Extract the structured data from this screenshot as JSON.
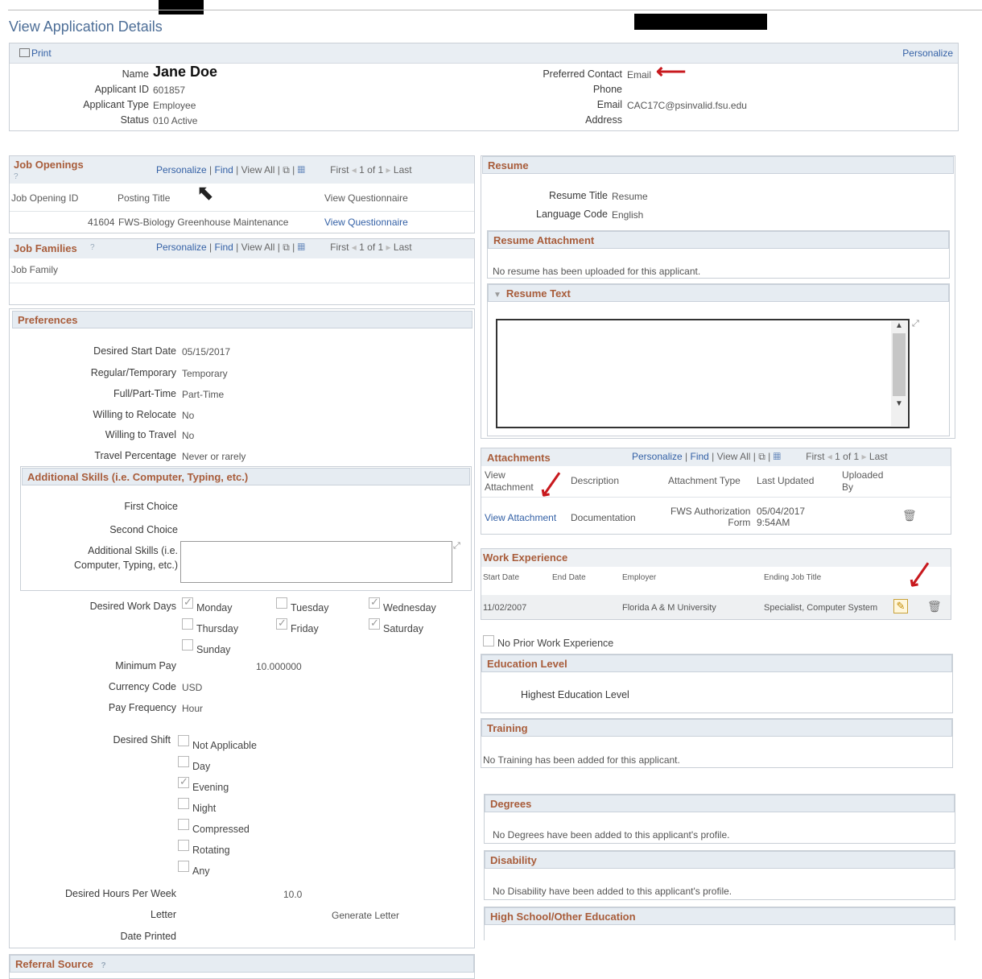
{
  "page_title": "View Application Details",
  "toolbar": {
    "print": "Print",
    "personalize": "Personalize"
  },
  "applicant": {
    "name_label": "Name",
    "name": "Jane Doe",
    "id_label": "Applicant ID",
    "id": "601857",
    "type_label": "Applicant Type",
    "type": "Employee",
    "status_label": "Status",
    "status": "010 Active",
    "pref_contact_label": "Preferred Contact",
    "pref_contact": "Email",
    "phone_label": "Phone",
    "email_label": "Email",
    "email": "CAC17C@psinvalid.fsu.edu",
    "address_label": "Address"
  },
  "grid_nav": {
    "personalize": "Personalize",
    "find": "Find",
    "view_all": "View All",
    "first": "First",
    "count": "1 of 1",
    "last": "Last"
  },
  "job_openings": {
    "title": "Job Openings",
    "cols": [
      "Job Opening ID",
      "Posting Title",
      "View Questionnaire"
    ],
    "row": {
      "id": "41604",
      "title": "FWS-Biology Greenhouse Maintenance",
      "link": "View Questionnaire"
    }
  },
  "job_families": {
    "title": "Job Families",
    "col": "Job Family"
  },
  "preferences": {
    "title": "Preferences",
    "rows": [
      {
        "label": "Desired Start Date",
        "value": "05/15/2017"
      },
      {
        "label": "Regular/Temporary",
        "value": "Temporary"
      },
      {
        "label": "Full/Part-Time",
        "value": "Part-Time"
      },
      {
        "label": "Willing to Relocate",
        "value": "No"
      },
      {
        "label": "Willing to Travel",
        "value": "No"
      },
      {
        "label": "Travel Percentage",
        "value": "Never or rarely"
      }
    ],
    "skills_title": "Additional Skills (i.e. Computer, Typing, etc.)",
    "first_choice": "First Choice",
    "second_choice": "Second Choice",
    "skills_field_1": "Additional Skills (i.e.",
    "skills_field_2": "Computer, Typing, etc.)",
    "work_days_label": "Desired Work Days",
    "days": [
      "Monday",
      "Tuesday",
      "Wednesday",
      "Thursday",
      "Friday",
      "Saturday",
      "Sunday"
    ],
    "min_pay_label": "Minimum Pay",
    "min_pay": "10.000000",
    "currency_label": "Currency Code",
    "currency": "USD",
    "freq_label": "Pay Frequency",
    "freq": "Hour",
    "shift_label": "Desired Shift",
    "shifts": [
      "Not Applicable",
      "Day",
      "Evening",
      "Night",
      "Compressed",
      "Rotating",
      "Any"
    ],
    "hours_label": "Desired Hours Per Week",
    "hours": "10.0",
    "letter_label": "Letter",
    "letter": "Generate Letter",
    "date_printed_label": "Date Printed"
  },
  "referral": {
    "title": "Referral Source"
  },
  "resume": {
    "title": "Resume",
    "title_label": "Resume Title",
    "title_value": "Resume",
    "lang_label": "Language Code",
    "lang_value": "English",
    "attach_title": "Resume Attachment",
    "attach_msg": "No resume has been uploaded for this applicant.",
    "text_title": "Resume Text"
  },
  "attachments": {
    "title": "Attachments",
    "cols": [
      "View Attachment",
      "Description",
      "Attachment Type",
      "Last Updated",
      "Uploaded By"
    ],
    "row": {
      "link": "View Attachment",
      "desc": "Documentation",
      "type1": "FWS Authorization",
      "type2": "Form",
      "date": "05/04/2017",
      "time": "9:54AM"
    }
  },
  "work_experience": {
    "title": "Work Experience",
    "cols": [
      "Start Date",
      "End Date",
      "Employer",
      "Ending Job Title"
    ],
    "row": {
      "start": "11/02/2007",
      "employer": "Florida A & M University",
      "job_title": "Specialist, Computer System"
    },
    "no_prior": "No Prior Work Experience"
  },
  "education": {
    "title": "Education Level",
    "label": "Highest Education Level"
  },
  "training": {
    "title": "Training",
    "msg": "No Training has been added for this applicant."
  },
  "degrees": {
    "title": "Degrees",
    "msg": "No Degrees have been added to this applicant's profile."
  },
  "disability": {
    "title": "Disability",
    "msg": "No Disability have been added to this applicant's profile."
  },
  "high_school": {
    "title": "High School/Other Education"
  }
}
